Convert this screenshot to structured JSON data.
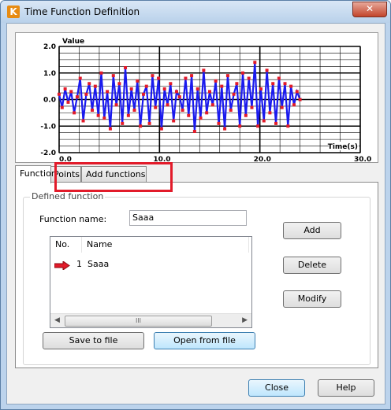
{
  "window": {
    "title": "Time Function Definition",
    "close_glyph": "✕",
    "icon_glyph": "K"
  },
  "chart_data": {
    "type": "line",
    "ylabel": "Value",
    "xlabel": "Time(s)",
    "xlim": [
      0,
      30
    ],
    "ylim": [
      -2,
      2
    ],
    "x_ticks": [
      "0.0",
      "10.0",
      "20.0",
      "30.0"
    ],
    "y_ticks": [
      "2.0",
      "1.0",
      "0.0",
      "-1.0",
      "-2.0"
    ],
    "grid": true,
    "series": [
      {
        "color": "#1a1aee",
        "marker_color": "#e21b2a",
        "x": [
          0.0,
          0.3,
          0.6,
          0.9,
          1.2,
          1.5,
          1.8,
          2.1,
          2.4,
          2.7,
          3.0,
          3.3,
          3.6,
          3.9,
          4.2,
          4.5,
          4.8,
          5.1,
          5.4,
          5.7,
          6.0,
          6.3,
          6.6,
          6.9,
          7.2,
          7.5,
          7.8,
          8.1,
          8.4,
          8.7,
          9.0,
          9.3,
          9.6,
          9.9,
          10.2,
          10.5,
          10.8,
          11.1,
          11.4,
          11.7,
          12.0,
          12.3,
          12.6,
          12.9,
          13.2,
          13.5,
          13.8,
          14.1,
          14.4,
          14.7,
          15.0,
          15.3,
          15.6,
          15.9,
          16.2,
          16.5,
          16.8,
          17.1,
          17.4,
          17.7,
          18.0,
          18.3,
          18.6,
          18.9,
          19.2,
          19.5,
          19.8,
          20.1,
          20.4,
          20.7,
          21.0,
          21.3,
          21.6,
          21.9,
          22.2,
          22.5,
          22.8,
          23.1,
          23.4,
          23.7,
          24.0
        ],
        "y": [
          0.2,
          -0.3,
          0.4,
          -0.1,
          0.3,
          -0.5,
          0.1,
          0.8,
          -0.8,
          0.2,
          0.6,
          -0.4,
          0.5,
          -0.6,
          1.0,
          -0.7,
          0.3,
          -1.1,
          0.9,
          -0.2,
          0.6,
          -0.9,
          1.2,
          -0.6,
          0.4,
          -0.4,
          0.7,
          -1.0,
          0.2,
          0.5,
          -0.9,
          0.9,
          -0.3,
          0.8,
          -1.1,
          0.4,
          -0.2,
          0.6,
          -0.8,
          0.3,
          0.1,
          -0.4,
          0.8,
          -0.6,
          0.9,
          -1.2,
          0.4,
          -0.7,
          1.1,
          -0.5,
          0.3,
          -0.2,
          0.7,
          -0.9,
          0.5,
          -1.1,
          0.9,
          -0.4,
          0.2,
          0.6,
          -1.0,
          1.0,
          -0.6,
          0.8,
          -0.3,
          1.4,
          -1.0,
          0.4,
          -0.8,
          1.1,
          -0.5,
          0.6,
          -0.9,
          0.8,
          -0.3,
          0.6,
          -1.0,
          0.5,
          -0.2,
          0.3,
          0.0
        ]
      }
    ]
  },
  "tabs": [
    "Function",
    "Points",
    "Add functions"
  ],
  "defined_function": {
    "group_label": "Defined function",
    "name_label": "Function name:",
    "name_value": "Saaa"
  },
  "list": {
    "columns": [
      "No.",
      "Name"
    ],
    "rows": [
      {
        "no": "1",
        "name": "Saaa"
      }
    ],
    "scroll_thumb": "III",
    "scroll_left": "◀",
    "scroll_right": "▶"
  },
  "buttons": {
    "add": "Add",
    "delete": "Delete",
    "modify": "Modify",
    "save_to_file": "Save to file",
    "open_from_file": "Open from file",
    "close": "Close",
    "help": "Help"
  }
}
